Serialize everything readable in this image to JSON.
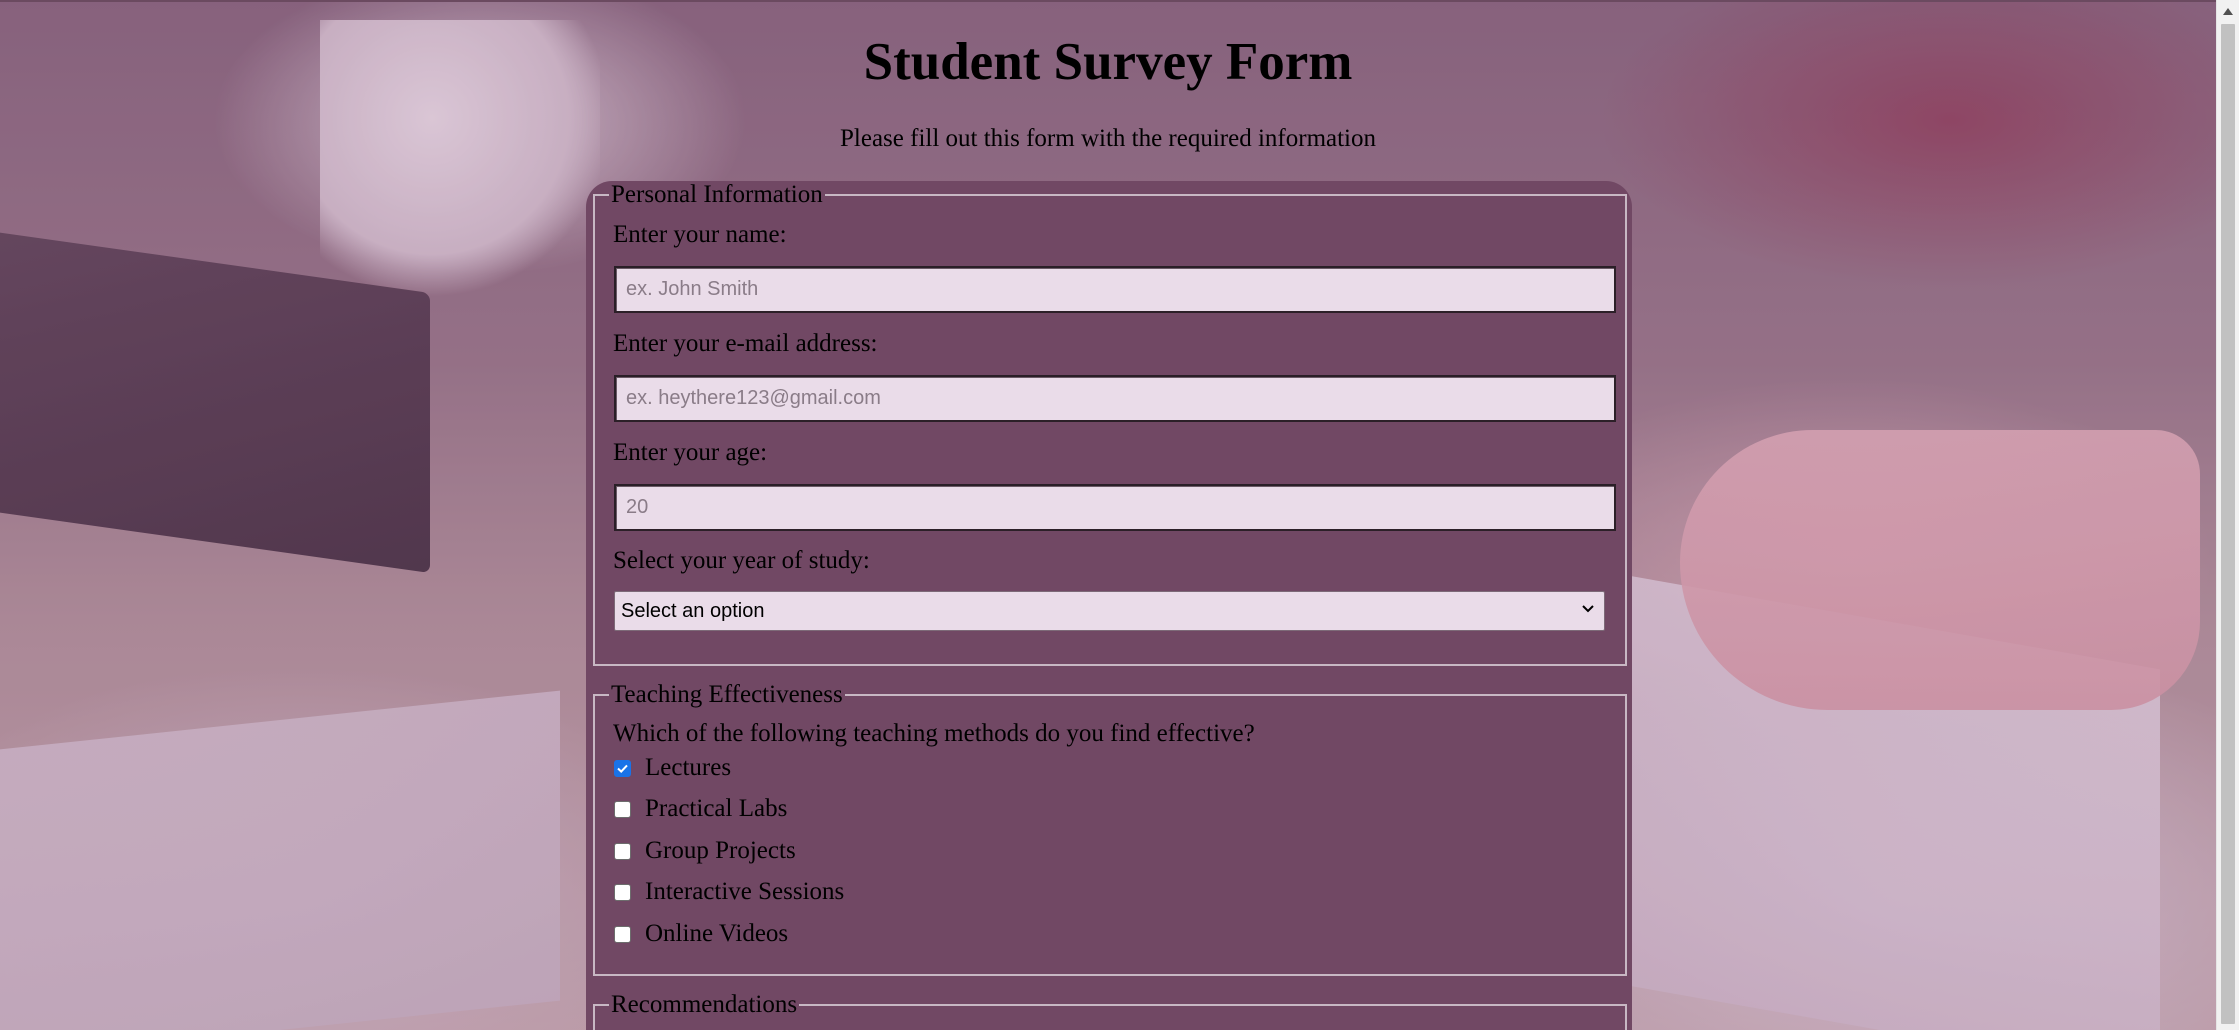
{
  "header": {
    "title": "Student Survey Form",
    "subtitle": "Please fill out this form with the required information"
  },
  "personal": {
    "legend": "Personal Information",
    "name_label": "Enter your name:",
    "name_placeholder": "ex. John Smith",
    "email_label": "Enter your e-mail address:",
    "email_placeholder": "ex. heythere123@gmail.com",
    "age_label": "Enter your age:",
    "age_placeholder": "20",
    "year_label": "Select your year of study:",
    "year_selected": "Select an option"
  },
  "teaching": {
    "legend": "Teaching Effectiveness",
    "question": "Which of the following teaching methods do you find effective?",
    "options": [
      {
        "label": "Lectures",
        "checked": true
      },
      {
        "label": "Practical Labs",
        "checked": false
      },
      {
        "label": "Group Projects",
        "checked": false
      },
      {
        "label": "Interactive Sessions",
        "checked": false
      },
      {
        "label": "Online Videos",
        "checked": false
      }
    ]
  },
  "recommendations": {
    "legend": "Recommendations"
  },
  "icons": {
    "scroll_up": "scroll-up-arrow-icon",
    "select_chevron": "chevron-down-icon",
    "checkmark": "checkmark-icon"
  },
  "colors": {
    "panel": "#714864",
    "input_bg": "#eadce9",
    "checkbox_checked": "#1a73e8"
  }
}
